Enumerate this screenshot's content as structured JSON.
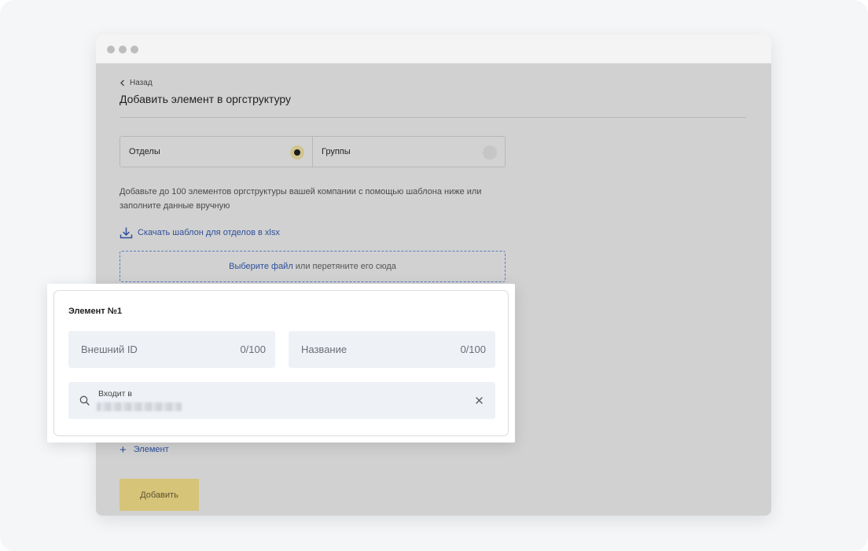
{
  "back": {
    "label": "Назад"
  },
  "page": {
    "title": "Добавить элемент в оргструктуру"
  },
  "tabs": [
    {
      "label": "Отделы",
      "selected": true
    },
    {
      "label": "Группы",
      "selected": false
    }
  ],
  "description": "Добавьте до 100 элементов оргструктуры вашей компании с помощью шаблона ниже или заполните данные вручную",
  "download": {
    "label": "Скачать шаблон для отделов в xlsx"
  },
  "dropzone": {
    "link": "Выберите файл",
    "text": "или перетяните его сюда"
  },
  "element_card": {
    "title": "Элемент №1",
    "external_id": {
      "placeholder": "Внешний ID",
      "counter": "0/100"
    },
    "name": {
      "placeholder": "Название",
      "counter": "0/100"
    },
    "parent": {
      "label": "Входит в"
    }
  },
  "add_element": {
    "label": "Элемент"
  },
  "submit": {
    "label": "Добавить"
  },
  "colors": {
    "accent": "#d6c479",
    "link": "#2d4f9a",
    "field_bg": "#eef1f5",
    "overlay": "#d1d1d1"
  }
}
